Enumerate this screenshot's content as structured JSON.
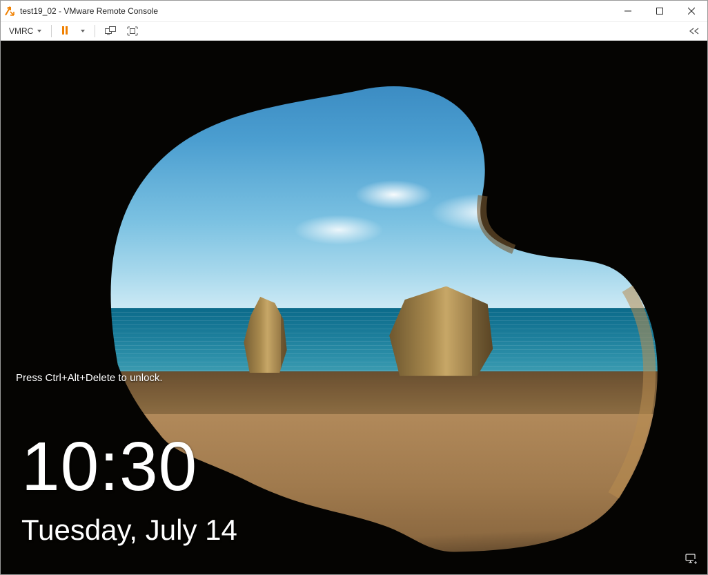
{
  "window": {
    "title": "test19_02 - VMware Remote Console"
  },
  "toolbar": {
    "menu_label": "VMRC"
  },
  "lockscreen": {
    "hint": "Press Ctrl+Alt+Delete to unlock.",
    "time": "10:30",
    "date": "Tuesday, July 14"
  }
}
